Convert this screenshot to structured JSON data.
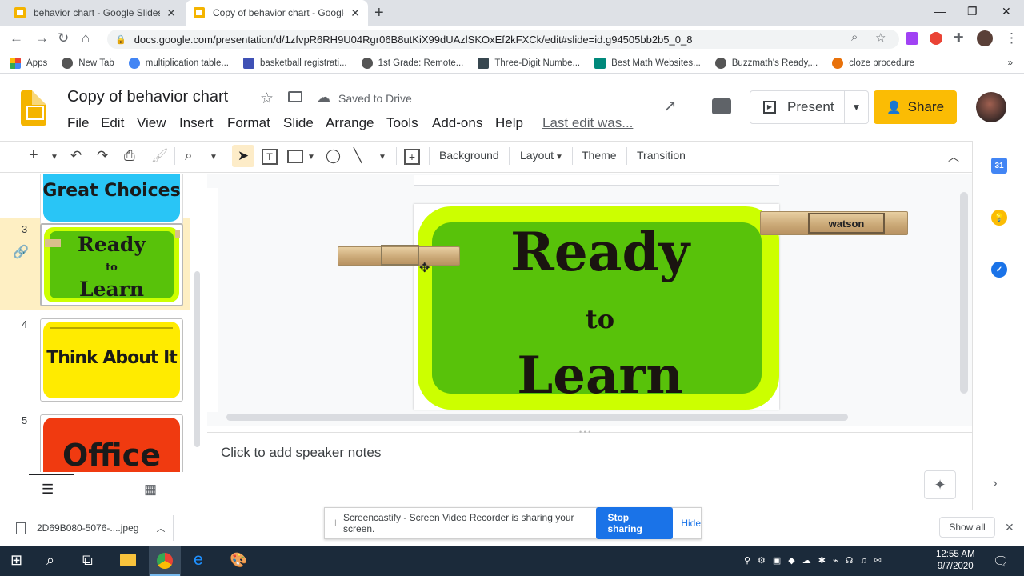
{
  "browser": {
    "tabs": [
      {
        "title": "behavior chart - Google Slides",
        "active": false
      },
      {
        "title": "Copy of behavior chart - Google",
        "active": true
      }
    ],
    "url": "docs.google.com/presentation/d/1zfvpR6RH9U04Rgr06B8utKiX99dUAzlSKOxEf2kFXCk/edit#slide=id.g94505bb2b5_0_8",
    "bookmarks": [
      "Apps",
      "New Tab",
      "multiplication table...",
      "basketball registrati...",
      "1st Grade: Remote...",
      "Three-Digit Numbe...",
      "Best Math Websites...",
      "Buzzmath's Ready,...",
      "cloze procedure"
    ]
  },
  "slides": {
    "doc_title": "Copy of behavior chart",
    "saved_status": "Saved to Drive",
    "menu": [
      "File",
      "Edit",
      "View",
      "Insert",
      "Format",
      "Slide",
      "Arrange",
      "Tools",
      "Add-ons",
      "Help"
    ],
    "last_edit": "Last edit was...",
    "present_label": "Present",
    "share_label": "Share",
    "toolbar": {
      "background": "Background",
      "layout": "Layout",
      "theme": "Theme",
      "transition": "Transition"
    },
    "filmstrip": [
      {
        "num": "",
        "text": "Great Choices",
        "color": "#29c5f6"
      },
      {
        "num": "3",
        "text_lines": [
          "Ready",
          "to",
          "Learn"
        ],
        "color": "#58c20a",
        "border": "#ccff00"
      },
      {
        "num": "4",
        "text": "Think About It",
        "color": "#ffeb00"
      },
      {
        "num": "5",
        "text": "Office",
        "color": "#f03a10"
      }
    ],
    "slide": {
      "line1": "Ready",
      "line2": "to",
      "line3": "Learn",
      "pin_label": "watson",
      "outer_color": "#ccff00",
      "inner_color": "#58c20a"
    },
    "notes_placeholder": "Click to add speaker notes"
  },
  "downloads": {
    "file": "2D69B080-5076-....jpeg",
    "show_all": "Show all"
  },
  "screencastify": {
    "message": "Screencastify - Screen Video Recorder is sharing your screen.",
    "stop": "Stop sharing",
    "hide": "Hide"
  },
  "taskbar": {
    "time": "12:55 AM",
    "date": "9/7/2020"
  }
}
